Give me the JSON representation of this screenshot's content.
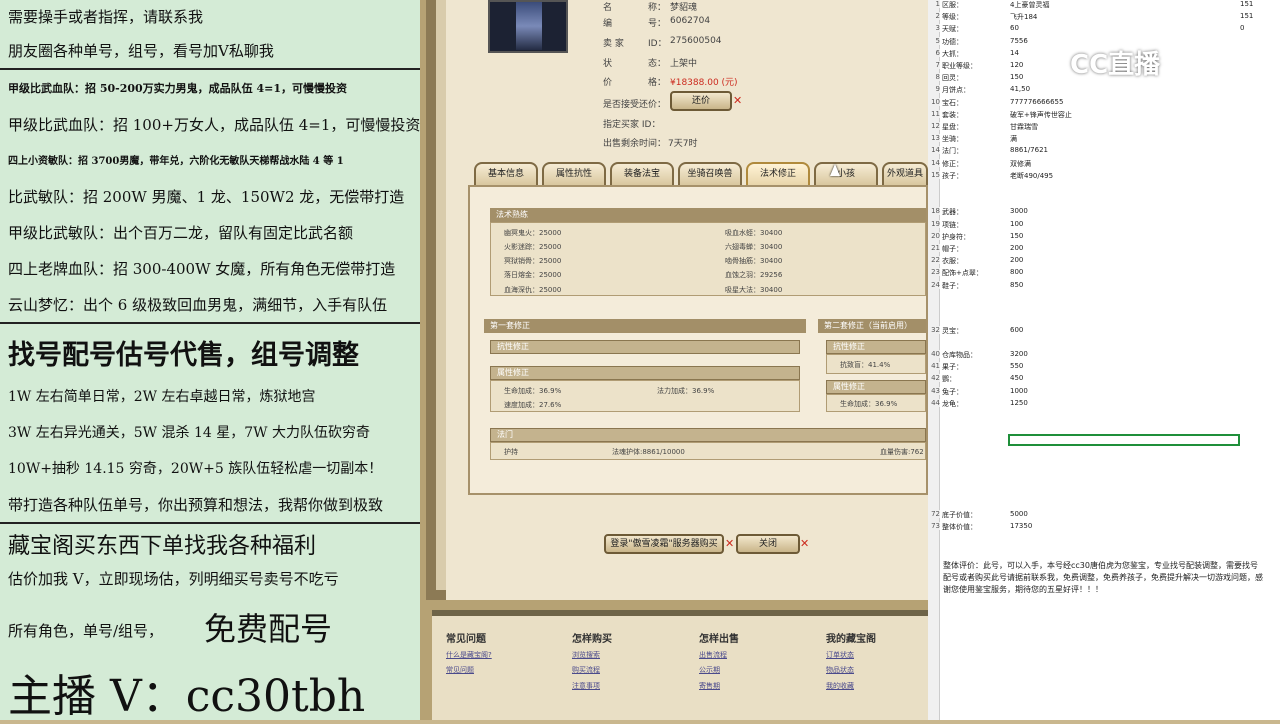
{
  "overlay": {
    "lines": [
      "需要操手或者指挥，请联系我",
      "朋友圈各种单号，组号，看号加V私聊我",
      "甲级比武血队：招 50-200万实力男鬼，成品队伍 4=1，可慢慢投资",
      "甲级比武血队：招 100+万女人，成品队伍 4=1，可慢慢投资",
      "四上小资敏队：招 3700男魔，带年兑，六阶化无敏队天梯帮战水陆 4 等 1",
      "比武敏队：招 200W 男魔、1 龙、150W2 龙，无偿带打造",
      "甲级比武敏队：出个百万二龙，留队有固定比武名额",
      "四上老牌血队：招 300-400W 女魔，所有角色无偿带打造",
      "云山梦忆：出个 6 级极致回血男鬼，满细节，入手有队伍",
      "找号配号估号代售，组号调整",
      "1W 左右简单日常，2W 左右卓越日常，炼狱地宫",
      "3W 左右异光通关，5W 混杀 14 星，7W 大力队伍砍穷奇",
      "10W+抽秒 14.15 穷奇，20W+5 族队伍轻松虐一切副本！",
      "带打造各种队伍单号，你出预算和想法，我帮你做到极致",
      "藏宝阁买东西下单找我各种福利",
      "估价加我 V，立即现场估，列明细买号卖号不吃亏",
      "所有角色，单号/组号，",
      "免费配号",
      "主播 V：cc30tbh"
    ]
  },
  "game": {
    "info": [
      [
        "名",
        "称：",
        "梦貂魂"
      ],
      [
        "编",
        "号：",
        "6062704"
      ],
      [
        "卖 家",
        "ID：",
        "275600504"
      ],
      [
        "状",
        "态：",
        "上架中"
      ],
      [
        "价",
        "格：",
        "¥18388.00 (元)"
      ]
    ],
    "bargain_label": "是否接受还价：",
    "bargain_btn": "还价",
    "designated_buyer": "指定买家 ID：",
    "remaining_label": "出售剩余时间：",
    "remaining_value": "7天7时",
    "tabs": [
      "基本信息",
      "属性抗性",
      "装备法宝",
      "坐骑召唤兽",
      "法术修正",
      "小孩",
      "外观道具"
    ],
    "spell_head": "法术熟练",
    "spells_left": [
      [
        "幽冥鬼火：25000"
      ],
      [
        "火影迷踪：25000"
      ],
      [
        "冥狱销骨：25000"
      ],
      [
        "落日熔金：25000"
      ],
      [
        "血海深仇：25000"
      ]
    ],
    "spells_right": [
      [
        "吸血水蛭：30400"
      ],
      [
        "六翅毒蝉：30400"
      ],
      [
        "啮骨抽筋：30400"
      ],
      [
        "血蚀之羽：29256"
      ],
      [
        "吸星大法：30400"
      ]
    ],
    "sec1": "第一套修正",
    "sec2": "第二套修正（当前启用）",
    "resist_head": "抗性修正",
    "attr_head": "属性修正",
    "attr1": [
      "生命加成：36.9%",
      "法力加成：36.9%",
      "速度加成：27.6%"
    ],
    "resist2": "抗致盲：41.4%",
    "attr2": "生命加成：36.9%",
    "magic_head": "法门",
    "magic_row": [
      "护持",
      "法魂护体:8861/10000",
      "血量伤害:762"
    ],
    "login_btn": "登录\"傲雪凌霜\"服务器购买",
    "close_btn": "关闭",
    "footer": {
      "cols": [
        {
          "title": "常见问题",
          "links": [
            "什么是藏宝阁?",
            "常见问题"
          ]
        },
        {
          "title": "怎样购买",
          "links": [
            "浏览搜索",
            "购买流程",
            "注意事项"
          ]
        },
        {
          "title": "怎样出售",
          "links": [
            "出售流程",
            "公示期",
            "寄售期"
          ]
        },
        {
          "title": "我的藏宝阁",
          "links": [
            "订单状态",
            "物品状态",
            "我的收藏"
          ]
        }
      ]
    }
  },
  "sheet": {
    "rows": [
      [
        "1",
        "区服：",
        "4上豪曾灵福",
        "151"
      ],
      [
        "2",
        "等级：",
        "飞升184",
        "151"
      ],
      [
        "3",
        "天赋：",
        "60",
        "0"
      ],
      [
        "5",
        "功德：",
        "7556",
        ""
      ],
      [
        "6",
        "大抓：",
        "14",
        ""
      ],
      [
        "7",
        "职业等级：",
        "120",
        ""
      ],
      [
        "8",
        "回灵：",
        "150",
        ""
      ],
      [
        "9",
        "月饼点：",
        "41,50",
        ""
      ],
      [
        "10",
        "宝石：",
        "777776666655",
        ""
      ],
      [
        "11",
        "套装：",
        "破军+锋声传世容止",
        ""
      ],
      [
        "12",
        "星盘：",
        "甘霖瑞雪",
        ""
      ],
      [
        "13",
        "坐骑：",
        "满",
        ""
      ],
      [
        "14",
        "法门：",
        "8861/7621",
        ""
      ],
      [
        "14",
        "修正：",
        "双修满",
        ""
      ],
      [
        "15",
        "孩子：",
        "老断490/495",
        ""
      ],
      [
        "",
        "",
        "",
        ""
      ],
      [
        "",
        "",
        "",
        ""
      ],
      [
        "18",
        "武器：",
        "3000",
        ""
      ],
      [
        "19",
        "项链：",
        "100",
        ""
      ],
      [
        "20",
        "护身符：",
        "150",
        ""
      ],
      [
        "21",
        "帽子：",
        "200",
        ""
      ],
      [
        "22",
        "衣服：",
        "200",
        ""
      ],
      [
        "23",
        "配饰+点翠：",
        "800",
        ""
      ],
      [
        "24",
        "鞋子：",
        "850",
        ""
      ]
    ],
    "rows2": [
      [
        "32",
        "灵宝：",
        "600"
      ],
      [
        "40",
        "仓库物品：",
        "3200"
      ],
      [
        "41",
        "果子：",
        "550"
      ],
      [
        "42",
        "鹦：",
        "450"
      ],
      [
        "43",
        "兔子：",
        "1000"
      ],
      [
        "44",
        "龙龟：",
        "1250"
      ]
    ],
    "rows3": [
      [
        "72",
        "底子价值：",
        "5000"
      ],
      [
        "73",
        "整体价值：",
        "17350"
      ]
    ],
    "summary": "整体评价：此号，可以入手，本号经cc30唐伯虎为您鉴宝，专业找号配装调整，需要找号配号或者购买此号请据前联系我，免费调整，免费养孩子，免费提升解决一切游戏问题，感谢您使用鉴宝服务，期待您的五星好评！！！",
    "logo": "CC直播"
  },
  "colors": {
    "overlay_bg": "#d4ebd6",
    "price": "#cc2a1e",
    "selection": "#1f8f3a"
  }
}
